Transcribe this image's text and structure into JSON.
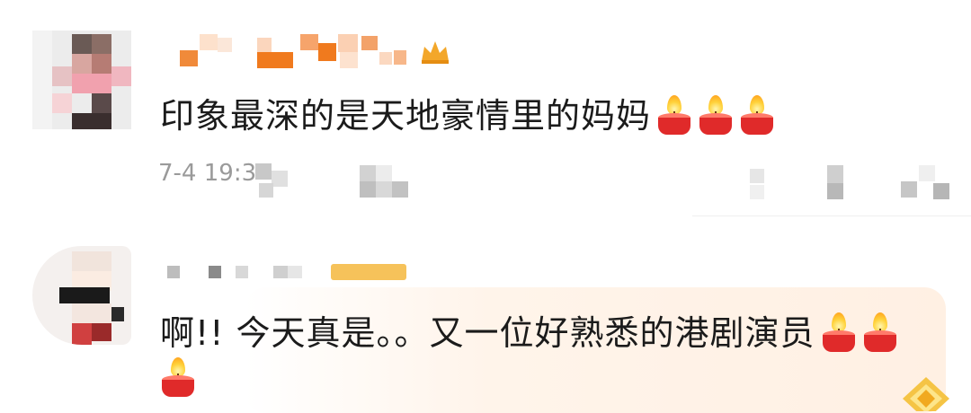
{
  "comments": [
    {
      "text": "印象最深的是天地豪情里的妈妈",
      "timestamp": "7-4 19:3",
      "reactions": [
        "candle-icon",
        "candle-icon",
        "candle-icon"
      ]
    },
    {
      "text": "啊!! 今天真是。。又一位好熟悉的港剧演员",
      "reactions": [
        "candle-icon",
        "candle-icon",
        "candle-icon"
      ]
    }
  ],
  "colors": {
    "text": "#1b1b1b",
    "timestamp": "#9a9a9a",
    "username_orange": "#f07a1e",
    "candle_red": "#e02a2a",
    "flame_yellow": "#ffd23a",
    "highlight_bg": "#fff0e3",
    "badge": "#f6c25a"
  }
}
